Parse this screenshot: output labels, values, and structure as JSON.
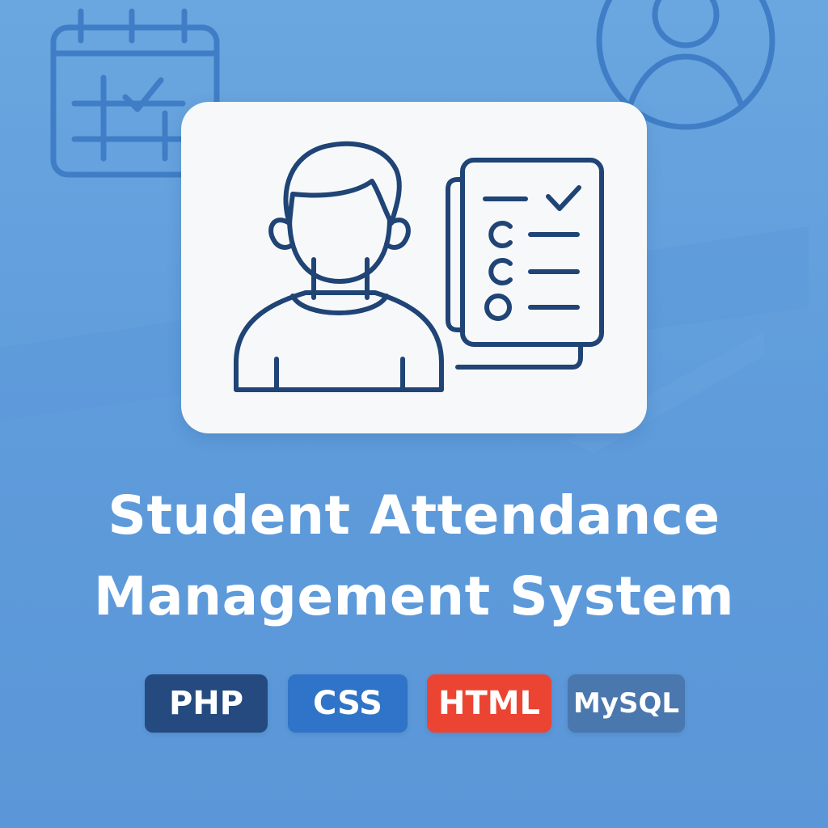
{
  "title": {
    "line1": "Student Attendance",
    "line2": "Management System"
  },
  "badges": [
    {
      "label": "PHP",
      "color": "#244a80"
    },
    {
      "label": "CSS",
      "color": "#2f74c8"
    },
    {
      "label": "HTML",
      "color": "#ec4432"
    },
    {
      "label": "MySQL",
      "color": "#4a77ad"
    }
  ],
  "icons": {
    "background": [
      "calendar-check-icon",
      "user-circle-icon"
    ],
    "card": [
      "student-icon",
      "checklist-icon"
    ]
  },
  "colors": {
    "background": "#5e9bdb",
    "card": "#f7f8fa",
    "outline": "#1f4475",
    "background_line": "#3e7cc4",
    "title": "#ffffff"
  }
}
